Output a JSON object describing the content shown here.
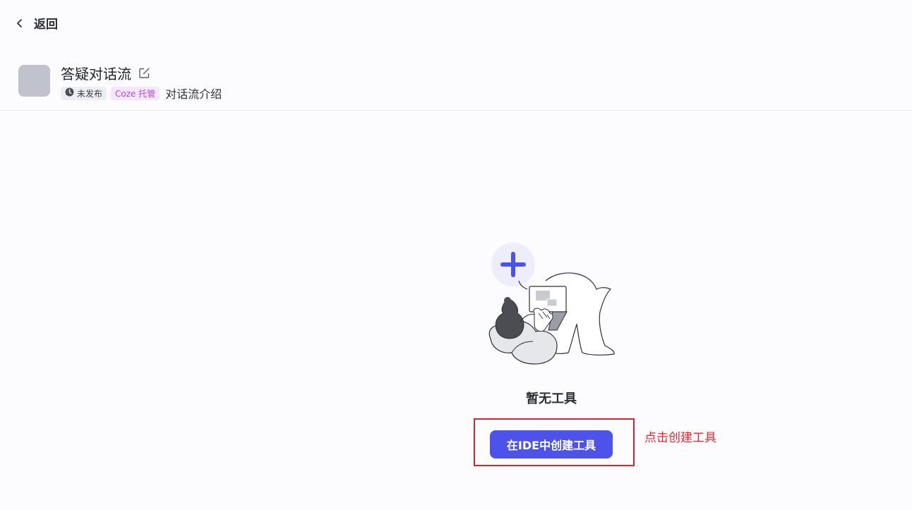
{
  "nav": {
    "back_label": "返回"
  },
  "header": {
    "title": "答疑对话流",
    "status_badge": "未发布",
    "host_badge": "Coze 托管",
    "description": "对话流介绍"
  },
  "empty_state": {
    "message": "暂无工具",
    "create_button_label": "在IDE中创建工具"
  },
  "annotation": {
    "text": "点击创建工具"
  },
  "colors": {
    "accent": "#4d53e8",
    "annotation": "#e0272f",
    "host_badge_bg": "#f5e6fd",
    "host_badge_text": "#b04ccb"
  },
  "icons": [
    "chevron-left-icon",
    "edit-icon",
    "clock-icon",
    "plus-icon"
  ]
}
